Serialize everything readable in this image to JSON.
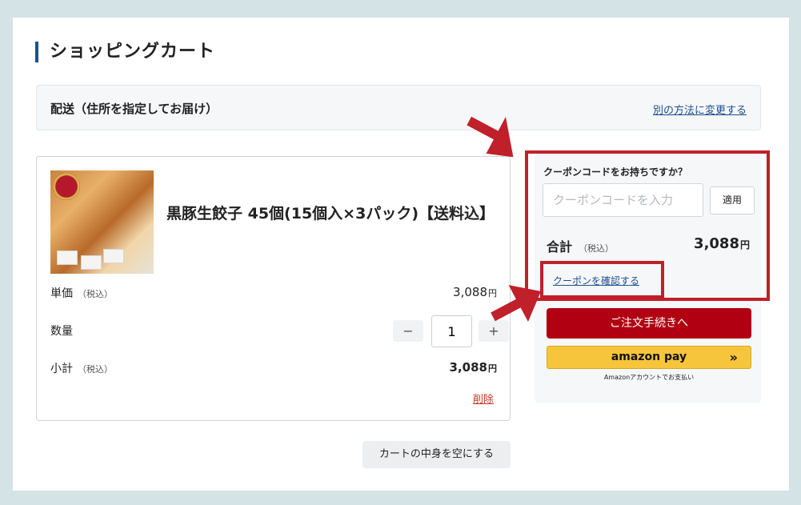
{
  "page": {
    "title": "ショッピングカート"
  },
  "delivery": {
    "label": "配送（住所を指定してお届け）",
    "change_link": "別の方法に変更する"
  },
  "item": {
    "name": "黒豚生餃子 45個(15個入×3パック)【送料込】",
    "unit_price_label": "単価",
    "unit_price_tax": "（税込）",
    "unit_price_value": "3,088",
    "quantity_label": "数量",
    "quantity_value": "1",
    "minus": "−",
    "plus": "+",
    "subtotal_label": "小計",
    "subtotal_tax": "（税込）",
    "subtotal_value": "3,088",
    "yen": "円",
    "delete_link": "削除"
  },
  "cart": {
    "empty_button": "カートの中身を空にする"
  },
  "coupon": {
    "question": "クーポンコードをお持ちですか？",
    "placeholder": "クーポンコードを入力",
    "apply_button": "適用",
    "confirm_link": "クーポンを確認する"
  },
  "summary": {
    "total_label": "合計",
    "total_tax": "（税込）",
    "total_value": "3,088",
    "yen": "円"
  },
  "checkout": {
    "order_button": "ご注文手続きへ",
    "amazon_logo": "amazon pay",
    "amazon_chevron": "»",
    "amazon_note": "Amazonアカウントでお支払い"
  },
  "colors": {
    "accent_blue": "#1d4f8c",
    "order_red": "#b00012",
    "highlight_red": "#c0202a",
    "amazon_yellow": "#f7c53b"
  }
}
